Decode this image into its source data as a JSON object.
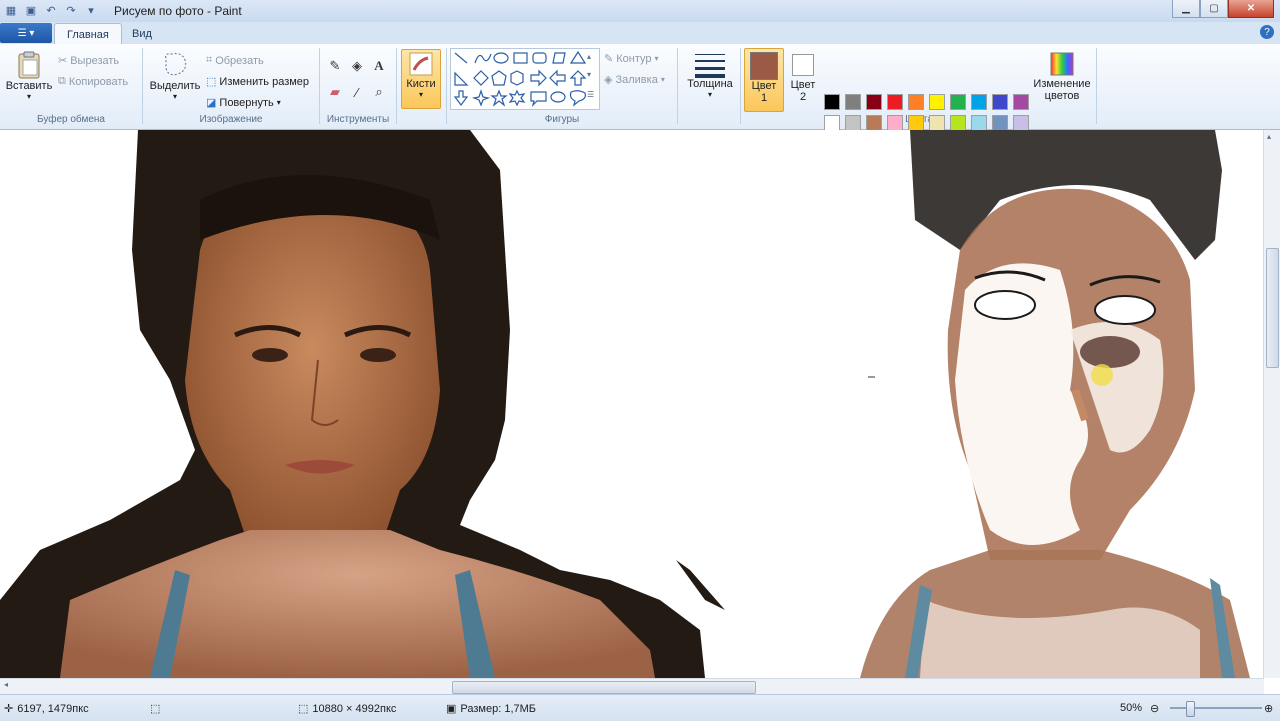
{
  "window": {
    "title": "Рисуем по фото - Paint"
  },
  "tabs": [
    {
      "label": "Главная"
    },
    {
      "label": "Вид"
    }
  ],
  "ribbon": {
    "clipboard": {
      "label": "Буфер обмена",
      "paste": "Вставить",
      "cut": "Вырезать",
      "copy": "Копировать"
    },
    "image": {
      "label": "Изображение",
      "select": "Выделить",
      "crop": "Обрезать",
      "resize": "Изменить размер",
      "rotate": "Повернуть"
    },
    "tools": {
      "label": "Инструменты"
    },
    "brushes": {
      "label": "Кисти"
    },
    "shapes": {
      "label": "Фигуры",
      "outline": "Контур",
      "fill": "Заливка"
    },
    "size": {
      "label": "Толщина"
    },
    "colors": {
      "label": "Цвета",
      "color1_label": "Цвет",
      "color1_num": "1",
      "color2_label": "Цвет",
      "color2_num": "2",
      "color1_value": "#9b5a46",
      "color2_value": "#ffffff",
      "edit_label_1": "Изменение",
      "edit_label_2": "цветов",
      "palette_row1": [
        "#000000",
        "#7f7f7f",
        "#880015",
        "#ed1c24",
        "#ff7f27",
        "#fff200",
        "#22b14c",
        "#00a2e8",
        "#3f48cc",
        "#a349a4"
      ],
      "palette_row2": [
        "#ffffff",
        "#c3c3c3",
        "#b97a57",
        "#ffaec9",
        "#ffc90e",
        "#efe4b0",
        "#b5e61d",
        "#99d9ea",
        "#7092be",
        "#c8bfe7"
      ]
    }
  },
  "status": {
    "cursor_pos": "6197, 1479пкс",
    "image_size": "10880 × 4992пкс",
    "file_size": "Размер: 1,7МБ",
    "zoom": "50%"
  }
}
